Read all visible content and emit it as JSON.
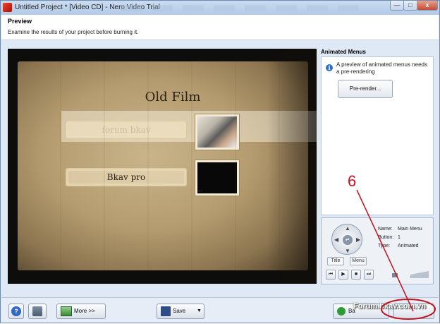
{
  "window": {
    "title": "Untitled Project * [Video CD] - Nero Video Trial",
    "min_glyph": "—",
    "max_glyph": "□",
    "close_glyph": "x"
  },
  "header": {
    "title": "Preview",
    "subtitle": "Examine the results of your project before burning it."
  },
  "preview": {
    "menu_title": "Old Film",
    "items": [
      {
        "label": "forum bkav"
      },
      {
        "label": "Bkav pro"
      }
    ],
    "thumb_label": "..."
  },
  "animated_menus": {
    "title": "Animated Menus",
    "info": "A preview of animated menus needs a pre-rendering",
    "prerender_label": "Pre-render..."
  },
  "remote": {
    "title_label": "Title",
    "menu_label": "Menu",
    "name_key": "Name:",
    "name_val": "Main Menu",
    "button_key": "Button:",
    "button_val": "1",
    "type_key": "Type:",
    "type_val": "Animated",
    "controls": [
      "⏮",
      "▶",
      "■",
      "⏭"
    ]
  },
  "bottom": {
    "help_glyph": "?",
    "more_label": "More >>",
    "save_label": "Save",
    "save_dd": "▼",
    "burn_label": "Ba",
    "watermark": "Forum.bkav.com.vn"
  },
  "annotation": {
    "number": "6",
    "color": "#c1121f"
  }
}
